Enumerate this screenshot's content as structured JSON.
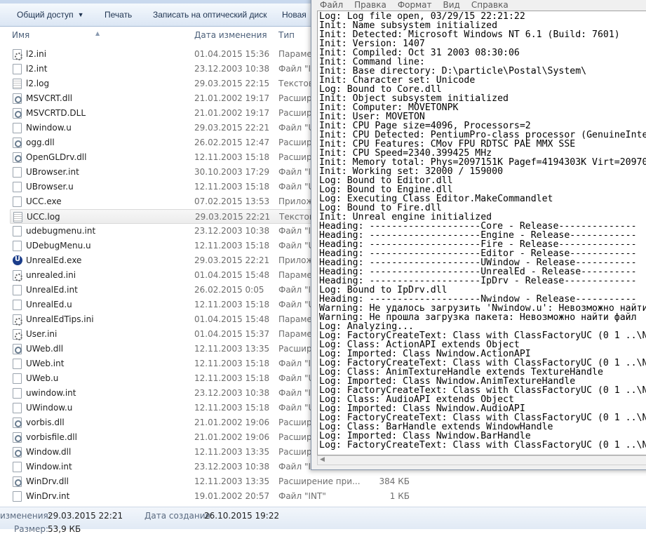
{
  "explorer": {
    "toolbar": {
      "share": "Общий доступ",
      "print": "Печать",
      "burn": "Записать на оптический диск",
      "new_folder": "Новая"
    },
    "columns": {
      "name": "Имя",
      "date": "Дата изменения",
      "type": "Тип"
    },
    "files": [
      {
        "icon": "ini",
        "name": "l2.ini",
        "date": "01.04.2015 15:36",
        "type": "Парамет"
      },
      {
        "icon": "file",
        "name": "l2.int",
        "date": "23.12.2003 10:38",
        "type": "Файл \"IN"
      },
      {
        "icon": "txt",
        "name": "l2.log",
        "date": "29.03.2015 22:15",
        "type": "Текстов"
      },
      {
        "icon": "dll",
        "name": "MSVCRT.dll",
        "date": "21.01.2002 19:17",
        "type": "Расшир"
      },
      {
        "icon": "dll",
        "name": "MSVCRTD.DLL",
        "date": "21.01.2002 19:17",
        "type": "Расшир"
      },
      {
        "icon": "file",
        "name": "Nwindow.u",
        "date": "29.03.2015 22:21",
        "type": "Файл \"U"
      },
      {
        "icon": "dll",
        "name": "ogg.dll",
        "date": "26.02.2015 12:47",
        "type": "Расшир"
      },
      {
        "icon": "dll",
        "name": "OpenGLDrv.dll",
        "date": "12.11.2003 15:18",
        "type": "Расшир"
      },
      {
        "icon": "file",
        "name": "UBrowser.int",
        "date": "30.10.2003 17:29",
        "type": "Файл \"IN"
      },
      {
        "icon": "file",
        "name": "UBrowser.u",
        "date": "12.11.2003 15:18",
        "type": "Файл \"U"
      },
      {
        "icon": "file",
        "name": "UCC.exe",
        "date": "07.02.2015 13:53",
        "type": "Прилож"
      },
      {
        "icon": "txt",
        "name": "UCC.log",
        "date": "29.03.2015 22:21",
        "type": "Текстов",
        "selected": true
      },
      {
        "icon": "file",
        "name": "udebugmenu.int",
        "date": "23.12.2003 10:38",
        "type": "Файл \"IN"
      },
      {
        "icon": "file",
        "name": "UDebugMenu.u",
        "date": "12.11.2003 15:18",
        "type": "Файл \"U"
      },
      {
        "icon": "exe",
        "name": "UnrealEd.exe",
        "date": "29.03.2015 22:21",
        "type": "Прилож"
      },
      {
        "icon": "ini",
        "name": "unrealed.ini",
        "date": "01.04.2015 15:48",
        "type": "Парамет"
      },
      {
        "icon": "file",
        "name": "UnrealEd.int",
        "date": "26.02.2015 0:05",
        "type": "Файл \"IN"
      },
      {
        "icon": "file",
        "name": "UnrealEd.u",
        "date": "12.11.2003 15:18",
        "type": "Файл \"U"
      },
      {
        "icon": "ini",
        "name": "UnrealEdTips.ini",
        "date": "01.04.2015 15:48",
        "type": "Парамет"
      },
      {
        "icon": "ini",
        "name": "User.ini",
        "date": "01.04.2015 15:37",
        "type": "Парамет"
      },
      {
        "icon": "dll",
        "name": "UWeb.dll",
        "date": "12.11.2003 13:35",
        "type": "Расшир"
      },
      {
        "icon": "file",
        "name": "UWeb.int",
        "date": "12.11.2003 15:18",
        "type": "Файл \"IN"
      },
      {
        "icon": "file",
        "name": "UWeb.u",
        "date": "12.11.2003 15:18",
        "type": "Файл \"U"
      },
      {
        "icon": "file",
        "name": "uwindow.int",
        "date": "23.12.2003 10:38",
        "type": "Файл \"IN"
      },
      {
        "icon": "file",
        "name": "UWindow.u",
        "date": "12.11.2003 15:18",
        "type": "Файл \"U"
      },
      {
        "icon": "dll",
        "name": "vorbis.dll",
        "date": "21.01.2002 19:06",
        "type": "Расшир"
      },
      {
        "icon": "dll",
        "name": "vorbisfile.dll",
        "date": "21.01.2002 19:06",
        "type": "Расшир"
      },
      {
        "icon": "dll",
        "name": "Window.dll",
        "date": "12.11.2003 13:35",
        "type": "Расшир"
      },
      {
        "icon": "file",
        "name": "Window.int",
        "date": "23.12.2003 10:38",
        "type": "Файл \"IN"
      },
      {
        "icon": "dll",
        "name": "WinDrv.dll",
        "date": "12.11.2003 13:35",
        "type": "Расширение при...",
        "size": "384 КБ"
      },
      {
        "icon": "file",
        "name": "WinDrv.int",
        "date": "19.01.2002 20:57",
        "type": "Файл \"INT\"",
        "size": "1 КБ"
      }
    ],
    "status": {
      "modified_label": "изменения:",
      "modified": "29.03.2015 22:21",
      "created_label": "Дата создания:",
      "created": "26.10.2015 19:22",
      "size_label": "Размер:",
      "size": "53,9 КБ"
    }
  },
  "notepad": {
    "menu": [
      "Файл",
      "Правка",
      "Формат",
      "Вид",
      "Справка"
    ],
    "lines": [
      "Log: Log file open, 03/29/15 22:21:22",
      "Init: Name subsystem initialized",
      "Init: Detected: Microsoft Windows NT 6.1 (Build: 7601)",
      "Init: Version: 1407",
      "Init: Compiled: Oct 31 2003 08:30:06",
      "Init: Command line:",
      "Init: Base directory: D:\\particle\\Postal\\System\\",
      "Init: Character set: Unicode",
      "Log: Bound to Core.dll",
      "Init: Object subsystem initialized",
      "Init: Computer: MOVETONPK",
      "Init: User: MOVETON",
      "Init: CPU Page size=4096, Processors=2",
      "Init: CPU Detected: PentiumPro-class processor (GenuineInte",
      "Init: CPU Features: CMov FPU RDTSC PAE MMX SSE",
      "Init: CPU Speed=2340.399425 MHz",
      "Init: Memory total: Phys=2097151K Pagef=4194303K Virt=20970",
      "Init: Working set: 32000 / 159000",
      "Log: Bound to Editor.dll",
      "Log: Bound to Engine.dll",
      "Log: Executing Class Editor.MakeCommandlet",
      "Log: Bound to Fire.dll",
      "Init: Unreal engine initialized",
      "Heading: --------------------Core - Release--------------",
      "Heading: --------------------Engine - Release------------",
      "Heading: --------------------Fire - Release--------------",
      "Heading: --------------------Editor - Release------------",
      "Heading: --------------------UWindow - Release-----------",
      "Heading: --------------------UnrealEd - Release----------",
      "Heading: --------------------IpDrv - Release-------------",
      "Log: Bound to IpDrv.dll",
      "Heading: --------------------Nwindow - Release-----------",
      "Warning: Не удалось загрузить 'Nwindow.u': Невозможно найти",
      "Warning: Не прошла загрузка пакета: Невозможно найти файл ",
      "Log: Analyzing...",
      "Log: FactoryCreateText: Class with ClassFactoryUC (0 1 ..\\N",
      "Log: Class: ActionAPI extends Object",
      "Log: Imported: Class Nwindow.ActionAPI",
      "Log: FactoryCreateText: Class with ClassFactoryUC (0 1 ..\\N",
      "Log: Class: AnimTextureHandle extends TextureHandle",
      "Log: Imported: Class Nwindow.AnimTextureHandle",
      "Log: FactoryCreateText: Class with ClassFactoryUC (0 1 ..\\N",
      "Log: Class: AudioAPI extends Object",
      "Log: Imported: Class Nwindow.AudioAPI",
      "Log: FactoryCreateText: Class with ClassFactoryUC (0 1 ..\\N",
      "Log: Class: BarHandle extends WindowHandle",
      "Log: Imported: Class Nwindow.BarHandle",
      "Log: FactoryCreateText: Class with ClassFactoryUC (0 1 ..\\N"
    ]
  }
}
